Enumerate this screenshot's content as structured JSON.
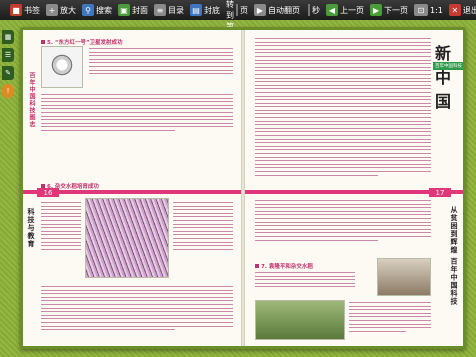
{
  "toolbar": {
    "bookmark": "书签",
    "zoom_in": "放大",
    "search": "搜索",
    "cover": "封面",
    "toc": "目录",
    "back_cover": "封底",
    "jump_to": "跳转到第",
    "page_unit": "页",
    "auto_flip": "自动翻页",
    "seconds": "秒",
    "prev_page": "上一页",
    "next_page": "下一页",
    "ratio": "1:1",
    "exit": "退出"
  },
  "book": {
    "left_page": {
      "page_number": "16",
      "vertical_title": "百年中国科技图志",
      "section_label": "科技与教育",
      "heading_1": "5. “东方红一号”卫星发射成功",
      "heading_2": "6. 杂交水稻培育成功"
    },
    "right_page": {
      "page_number": "17",
      "logo": "新中国",
      "logo_sub": "百年中国科技",
      "vertical_title": "从贫困到辉煌 百年中国科技",
      "heading_3": "7. 袁隆平和杂交水稻"
    }
  },
  "colors": {
    "accent": "#e0377a",
    "toolbar": "#1c1c1c",
    "background": "#8caf3c"
  }
}
